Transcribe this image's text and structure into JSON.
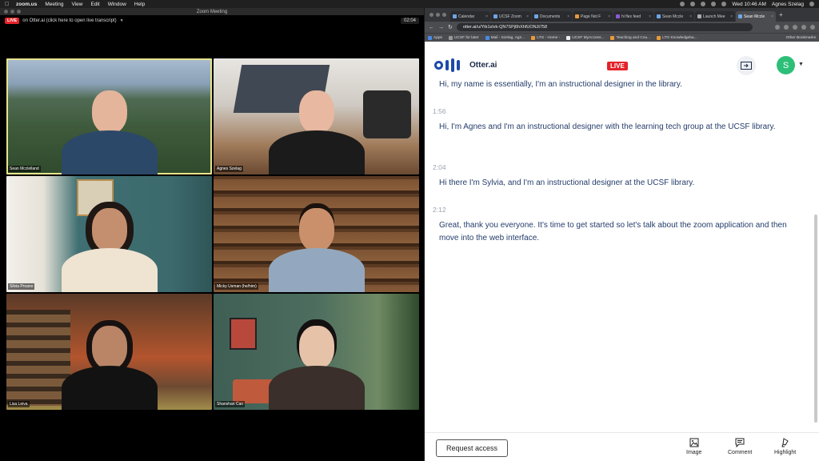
{
  "menubar": {
    "items": [
      "zoom.us",
      "Meeting",
      "View",
      "Edit",
      "Window",
      "Help"
    ],
    "clock": "Wed 10:46 AM",
    "user": "Agnes Szelag"
  },
  "zoom": {
    "window_title": "Zoom Meeting",
    "live_label": "LIVE",
    "otter_link": "on Otter.ai (click here to open live transcript)",
    "timer": "02:04",
    "participants": [
      {
        "name": "Sean Mcclelland",
        "active": true
      },
      {
        "name": "Agnes Szelag",
        "active": false
      },
      {
        "name": "Silvia Proano",
        "active": false
      },
      {
        "name": "Micky Usman (he/him)",
        "active": false
      },
      {
        "name": "Lisa Leiva",
        "active": false
      },
      {
        "name": "Shanshan Cao",
        "active": false
      }
    ]
  },
  "browser": {
    "tabs": [
      {
        "label": "Calendar",
        "active": false
      },
      {
        "label": "UCSF Zoom",
        "active": false
      },
      {
        "label": "Documents",
        "active": false
      },
      {
        "label": "Page Not F",
        "active": false
      },
      {
        "label": "hi flex feed",
        "active": false
      },
      {
        "label": "Sean Mccle",
        "active": false
      },
      {
        "label": "Launch Mee",
        "active": false
      },
      {
        "label": "Sean Mccle",
        "active": true
      }
    ],
    "url": "otter.ai/u/Ytk1sIvk-QN7SPj6hXhfUONJt758",
    "bookmarks": [
      "Apps",
      "UCSF for later",
      "Mail - Szelag, Agn...",
      "LTG - Home -",
      "UCSF MyAccess...",
      "Teaching and Cou...",
      "LTG Knowledgeba..."
    ],
    "other_bookmarks": "Other Bookmarks"
  },
  "otter": {
    "brand": "Otter.ai",
    "live_label": "LIVE",
    "avatar_letter": "S",
    "segments": [
      {
        "time": "",
        "text": "Hi, my name is essentially, I'm an instructional designer in the library."
      },
      {
        "time": "1:56",
        "text": "Hi, I'm Agnes and I'm an instructional designer with the learning tech group at the UCSF library."
      },
      {
        "time": "2:04",
        "text": "Hi there I'm Sylvia, and I'm an instructional designer at the UCSF library."
      },
      {
        "time": "2:12",
        "text": "Great, thank you everyone. It's time to get started so let's talk about the zoom application and then move into the web interface."
      }
    ],
    "request_access": "Request access",
    "footer_actions": [
      "Image",
      "Comment",
      "Highlight"
    ]
  }
}
